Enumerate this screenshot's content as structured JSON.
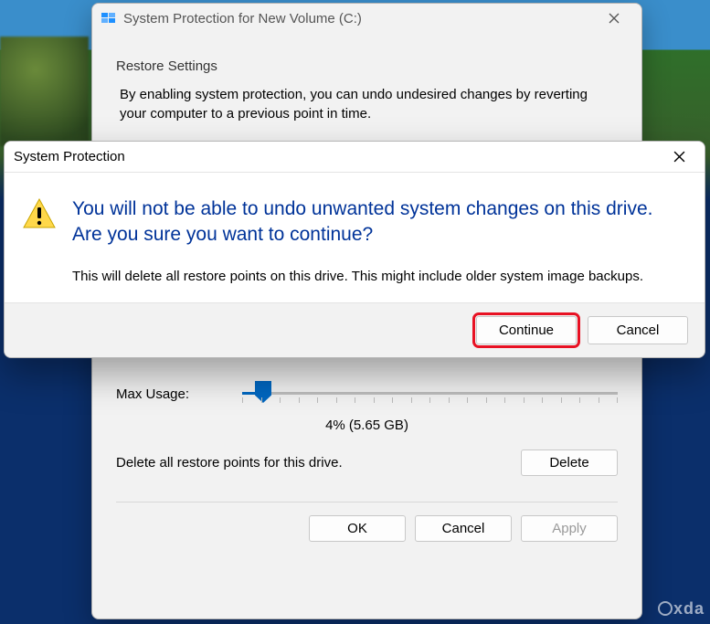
{
  "parent": {
    "title": "System Protection for New Volume (C:)",
    "restore_settings_heading": "Restore Settings",
    "restore_settings_text": "By enabling system protection, you can undo undesired changes by reverting your computer to a previous point in time.",
    "max_usage_label": "Max Usage:",
    "usage_value": "4% (5.65 GB)",
    "delete_text": "Delete all restore points for this drive.",
    "delete_button": "Delete",
    "ok_button": "OK",
    "cancel_button": "Cancel",
    "apply_button": "Apply"
  },
  "confirm": {
    "title": "System Protection",
    "heading": "You will not be able to undo unwanted system changes on this drive. Are you sure you want to continue?",
    "body": "This will delete all restore points on this drive. This might include older system image backups.",
    "continue_button": "Continue",
    "cancel_button": "Cancel"
  },
  "watermark": "xda"
}
